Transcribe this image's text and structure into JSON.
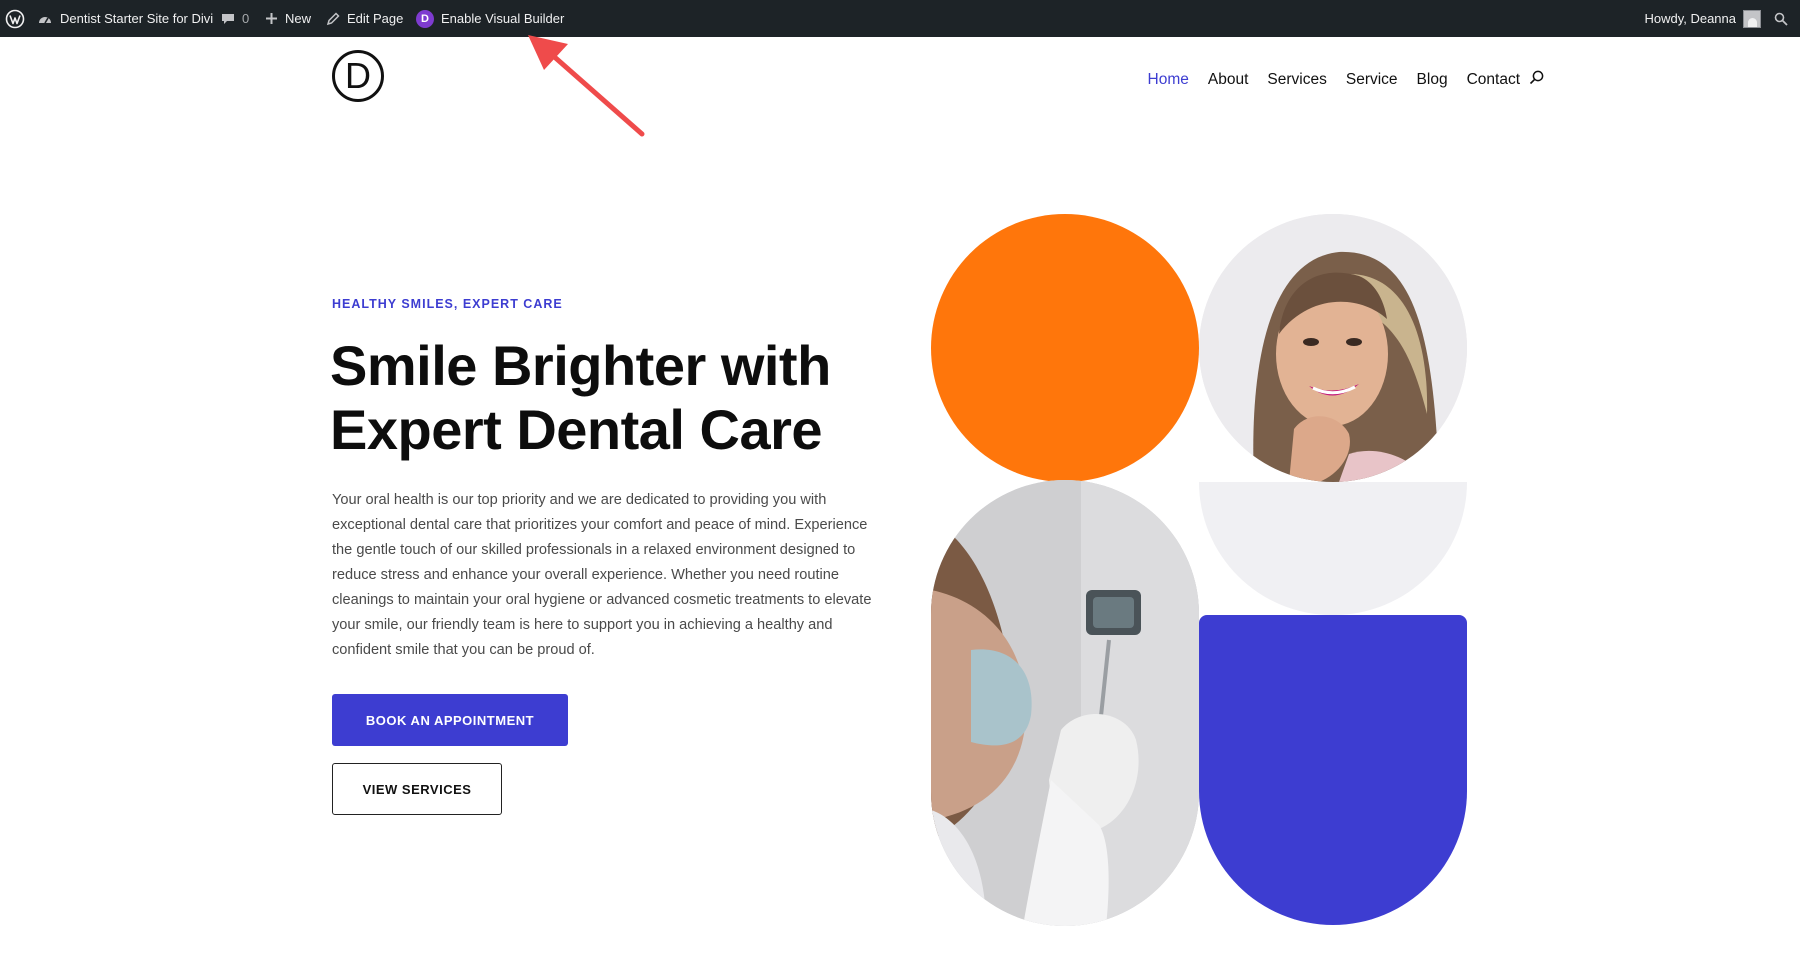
{
  "adminbar": {
    "site_name": "Dentist Starter Site for Divi",
    "comments_count": "0",
    "new_label": "New",
    "edit_label": "Edit Page",
    "builder_badge": "D",
    "builder_label": "Enable Visual Builder",
    "howdy": "Howdy, Deanna"
  },
  "header": {
    "logo_letter": "D",
    "nav": [
      "Home",
      "About",
      "Services",
      "Service",
      "Blog",
      "Contact"
    ],
    "active": "Home"
  },
  "hero": {
    "eyebrow": "HEALTHY SMILES, EXPERT CARE",
    "title": "Smile Brighter with Expert Dental Care",
    "body": "Your oral health is our top priority and we are dedicated to providing you with exceptional dental care that prioritizes your comfort and peace of mind. Experience the gentle touch of our skilled professionals in a relaxed environment designed to reduce stress and enhance your overall experience. Whether you need routine cleanings to maintain your oral hygiene or advanced cosmetic treatments to elevate your smile, our friendly team is here to support you in achieving a healthy and confident smile that you can be proud of.",
    "primary_button": "BOOK AN APPOINTMENT",
    "secondary_button": "VIEW SERVICES"
  },
  "colors": {
    "accent": "#3d3dd1",
    "orange": "#ff760b",
    "annotation_arrow": "#ef4b4b",
    "adminbar_bg": "#1d2327"
  },
  "icons": [
    "wordpress-icon",
    "dashboard-icon",
    "comment-icon",
    "plus-icon",
    "pencil-icon",
    "divi-icon",
    "avatar",
    "search-icon"
  ]
}
